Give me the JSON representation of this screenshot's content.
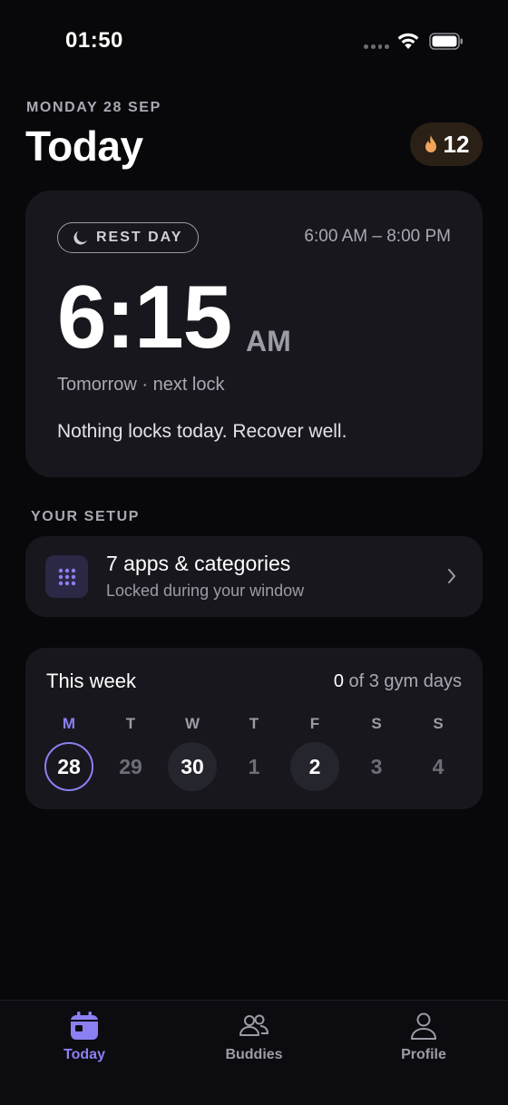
{
  "status_bar": {
    "time": "01:50"
  },
  "header": {
    "date": "MONDAY 28 SEP",
    "title": "Today",
    "streak": "12"
  },
  "lock_card": {
    "badge": "REST DAY",
    "window": "6:00 AM – 8:00 PM",
    "time": "6:15",
    "ampm": "AM",
    "next_lock": "Tomorrow · next lock",
    "message": "Nothing locks today. Recover well."
  },
  "setup": {
    "section_label": "YOUR SETUP",
    "title": "7 apps & categories",
    "subtitle": "Locked during your window"
  },
  "week": {
    "title": "This week",
    "progress_count": "0",
    "progress_rest": " of 3 gym days",
    "days": [
      {
        "letter": "M",
        "num": "28",
        "state": "today"
      },
      {
        "letter": "T",
        "num": "29",
        "state": "none"
      },
      {
        "letter": "W",
        "num": "30",
        "state": "gym"
      },
      {
        "letter": "T",
        "num": "1",
        "state": "none"
      },
      {
        "letter": "F",
        "num": "2",
        "state": "gym"
      },
      {
        "letter": "S",
        "num": "3",
        "state": "none"
      },
      {
        "letter": "S",
        "num": "4",
        "state": "none"
      }
    ]
  },
  "tabs": [
    {
      "label": "Today",
      "icon": "calendar-icon",
      "active": true
    },
    {
      "label": "Buddies",
      "icon": "buddies-icon",
      "active": false
    },
    {
      "label": "Profile",
      "icon": "profile-icon",
      "active": false
    }
  ],
  "colors": {
    "background": "#08080b",
    "card": "#17171d",
    "accent": "#8b80f2",
    "streak_flame": "#f0a35a"
  }
}
